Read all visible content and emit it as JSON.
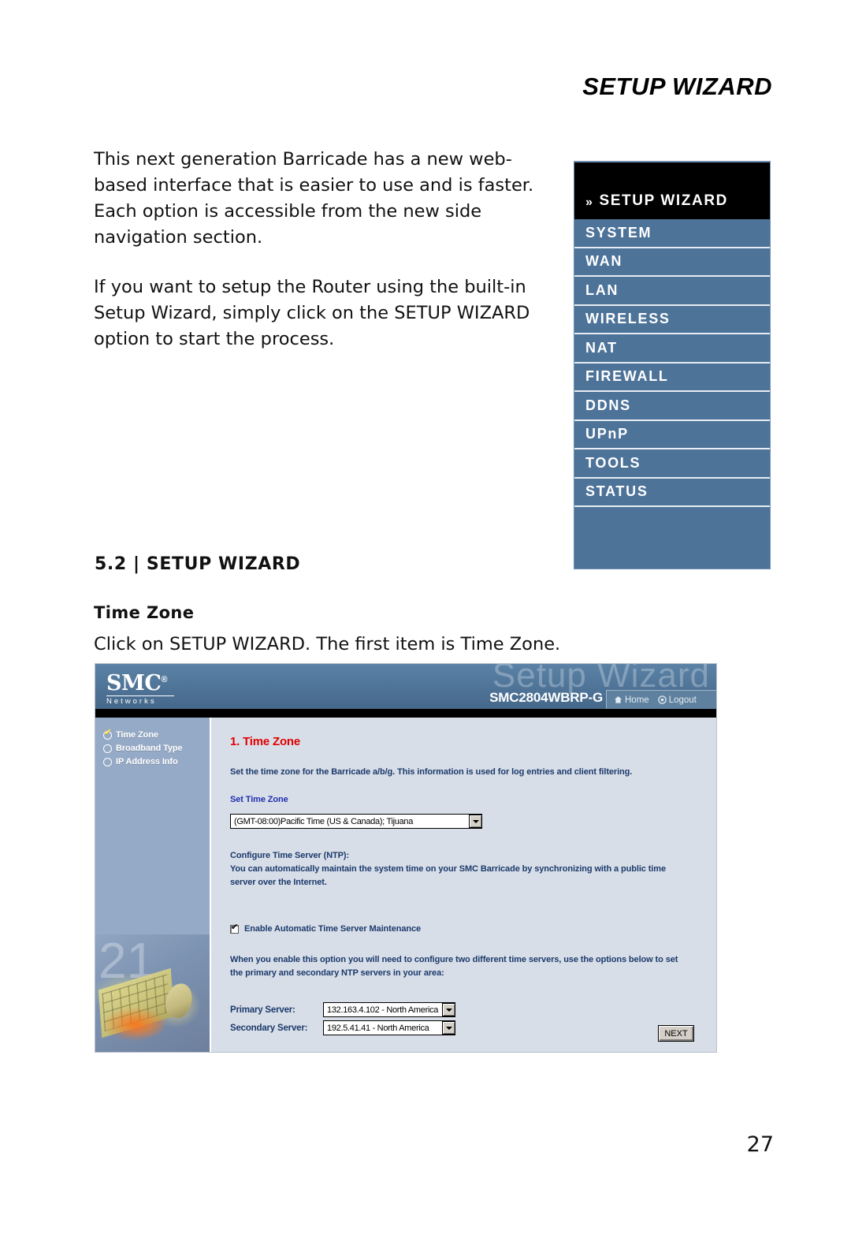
{
  "page": {
    "header_title": "SETUP WIZARD",
    "number": "27"
  },
  "intro": {
    "paragraph1": "This next generation Barricade has a new web-based interface that is easier to use and is faster. Each option is accessible from the new side navigation section.",
    "paragraph2": "If you want to setup the Router using the built-in Setup Wizard, simply click on the SETUP WIZARD option to start the process."
  },
  "nav_menu": {
    "chevron": "»",
    "active_label": "SETUP WIZARD",
    "items": [
      {
        "label": "SYSTEM"
      },
      {
        "label": "WAN"
      },
      {
        "label": "LAN"
      },
      {
        "label": "WIRELESS"
      },
      {
        "label": "NAT"
      },
      {
        "label": "FIREWALL"
      },
      {
        "label": "DDNS"
      },
      {
        "label": "UPnP"
      },
      {
        "label": "TOOLS"
      },
      {
        "label": "STATUS"
      }
    ],
    "accent_color": "#4d7399"
  },
  "section": {
    "number_title": "5.2 | SETUP WIZARD",
    "sub_heading": "Time Zone",
    "sub_caption": "Click on SETUP WIZARD. The first item is Time Zone."
  },
  "screenshot": {
    "brand": {
      "name": "SMC",
      "registered": "®",
      "tagline": "Networks"
    },
    "watermark": "Setup Wizard",
    "model": "SMC2804WBRP-G",
    "home_label": "Home",
    "logout_label": "Logout",
    "steps": [
      {
        "label": "Time Zone",
        "checked": true
      },
      {
        "label": "Broadband Type",
        "checked": false
      },
      {
        "label": "IP Address Info",
        "checked": false
      }
    ],
    "main": {
      "title": "1. Time Zone",
      "description": "Set the time zone for the Barricade a/b/g. This information is used for log entries and client filtering.",
      "set_time_zone_label": "Set Time Zone",
      "time_zone_value": "(GMT-08:00)Pacific Time (US & Canada); Tijuana",
      "ntp_heading": "Configure Time Server (NTP):",
      "ntp_description": "You can automatically maintain the system time on your SMC Barricade by synchronizing with a public time server over the Internet.",
      "enable_checkbox_label": "Enable Automatic Time Server Maintenance",
      "enable_checkbox_checked": true,
      "servers_description": "When you enable this option you will need to configure two different time servers, use the options below to set the primary and secondary NTP servers in your area:",
      "primary_label": "Primary Server:",
      "primary_value": "132.163.4.102 - North America",
      "secondary_label": "Secondary Server:",
      "secondary_value": "192.5.41.41 - North America",
      "next_label": "NEXT"
    },
    "colors": {
      "header_blue": "#4d7296",
      "sidebar_blue": "#95aac6",
      "panel_bg": "#d8dee8",
      "title_red": "#e00000",
      "label_blue": "#2030b0",
      "text_blue": "#1b3a6b"
    }
  }
}
